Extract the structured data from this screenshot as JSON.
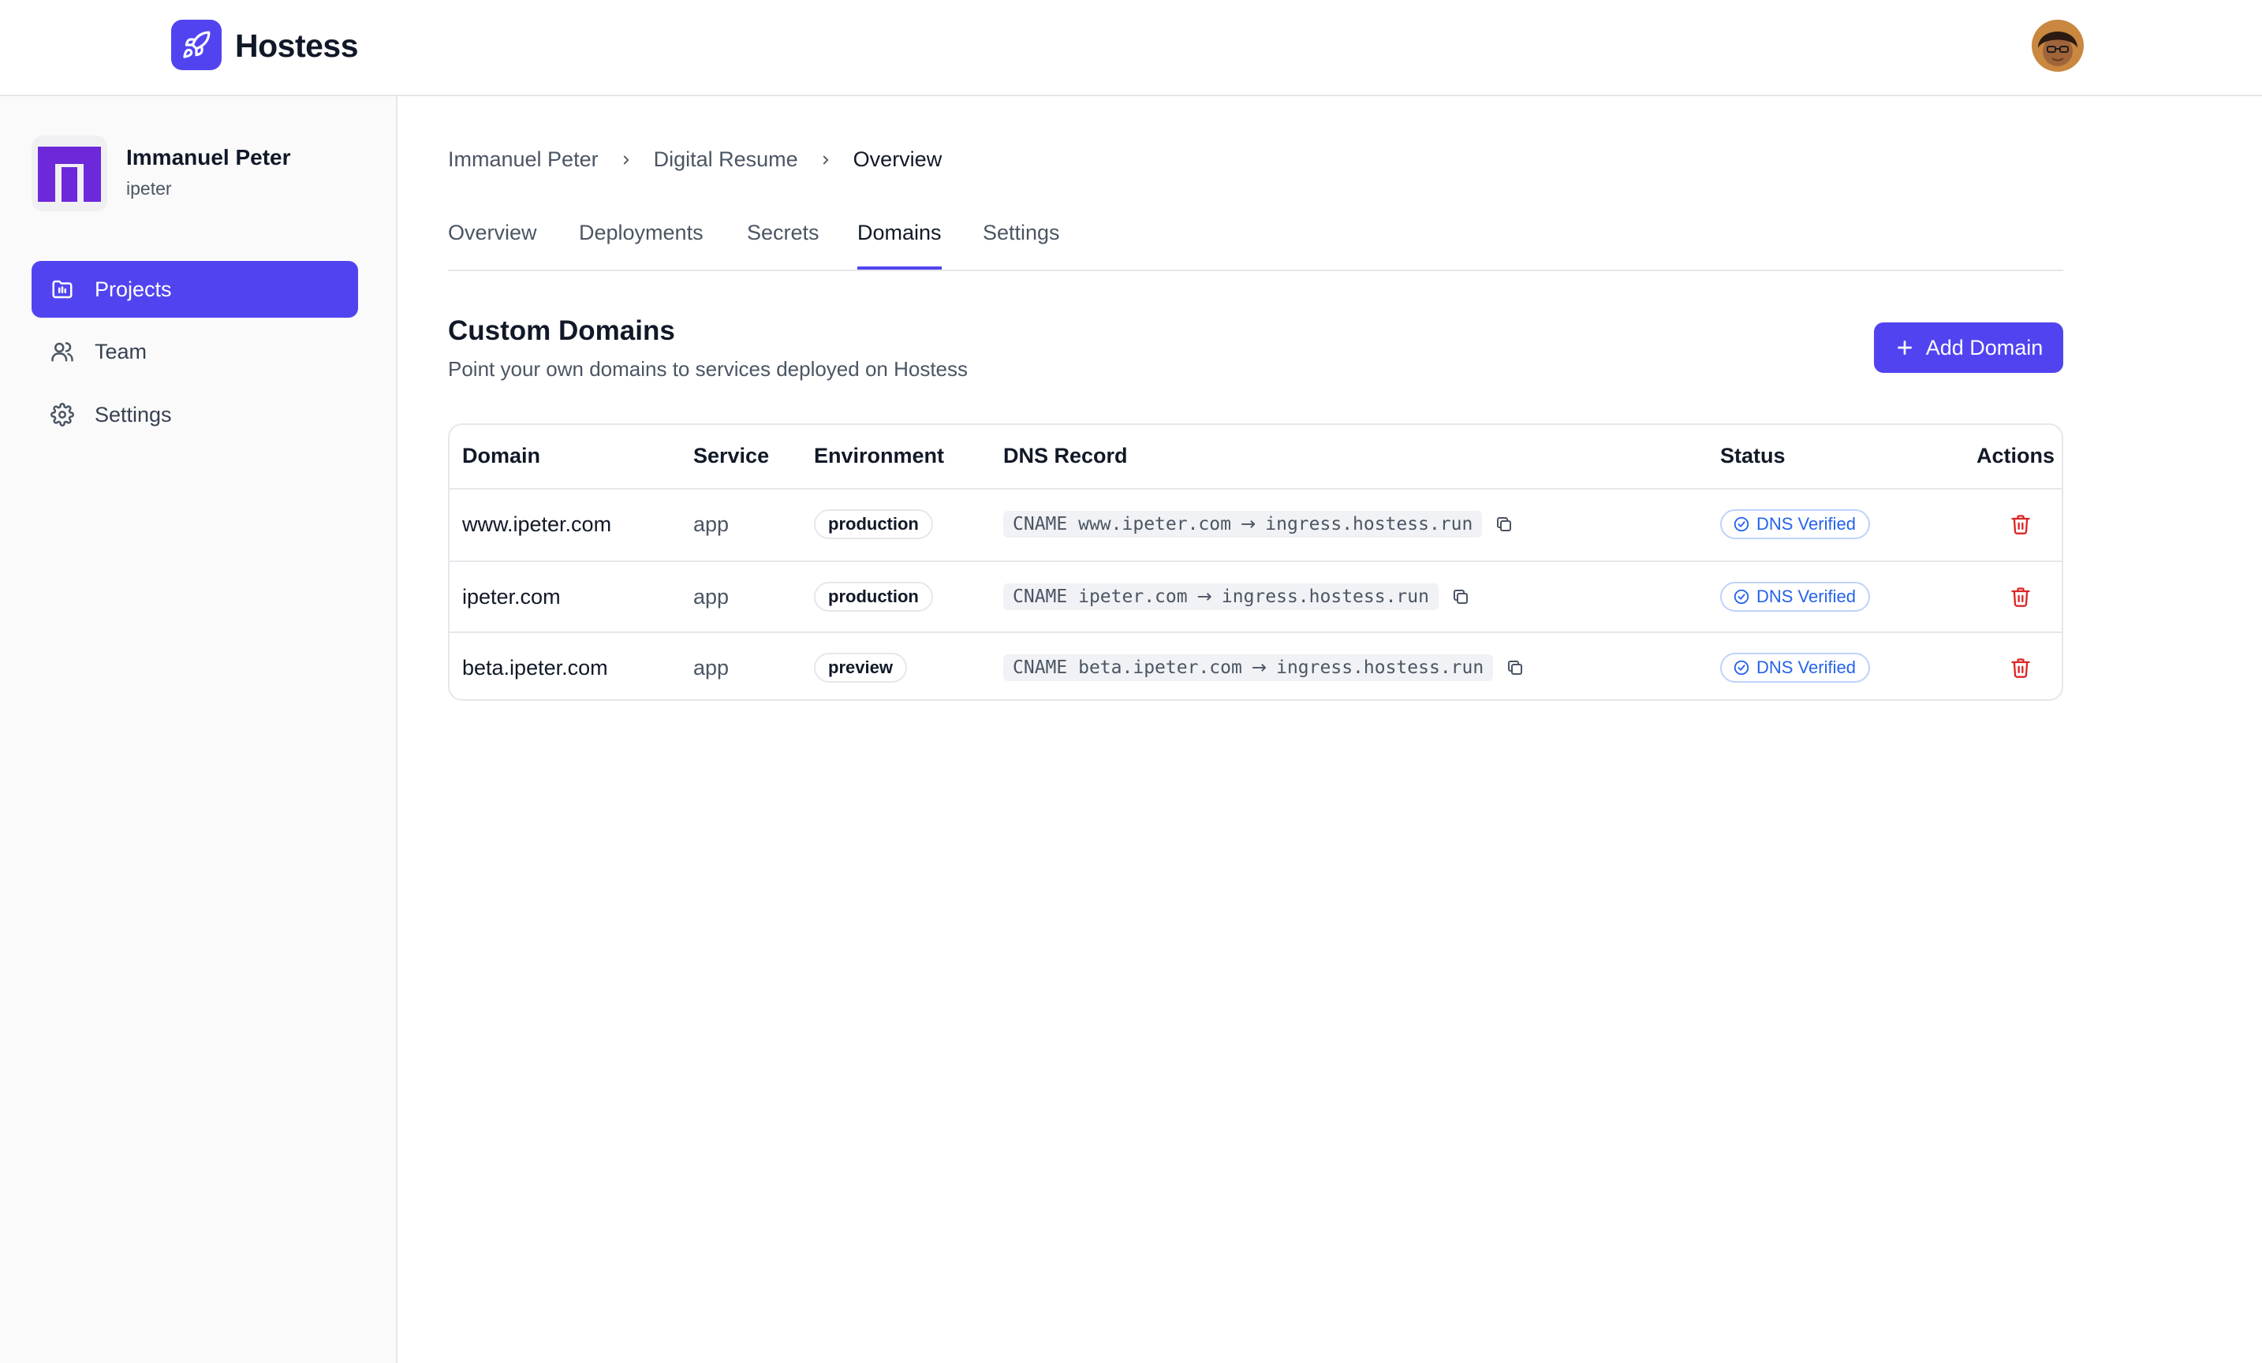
{
  "app": {
    "name": "Hostess",
    "logo_icon": "rocket-icon",
    "avatar_icon": "user-avatar"
  },
  "colors": {
    "accent": "#5144f0",
    "verified": "#2563eb",
    "danger": "#dc2626"
  },
  "org": {
    "name": "Immanuel Peter",
    "handle": "ipeter"
  },
  "sidebar": {
    "items": [
      {
        "label": "Projects",
        "icon": "folder-icon",
        "active": true
      },
      {
        "label": "Team",
        "icon": "users-icon",
        "active": false
      },
      {
        "label": "Settings",
        "icon": "gear-icon",
        "active": false
      }
    ]
  },
  "breadcrumb": [
    "Immanuel Peter",
    "Digital Resume",
    "Overview"
  ],
  "tabs": [
    {
      "label": "Overview",
      "active": false
    },
    {
      "label": "Deployments",
      "active": false
    },
    {
      "label": "Secrets",
      "active": false
    },
    {
      "label": "Domains",
      "active": true
    },
    {
      "label": "Settings",
      "active": false
    }
  ],
  "section": {
    "title": "Custom Domains",
    "subtitle": "Point your own domains to services deployed on Hostess",
    "add_button": "Add Domain"
  },
  "table": {
    "headers": {
      "domain": "Domain",
      "service": "Service",
      "environment": "Environment",
      "dns": "DNS Record",
      "status": "Status",
      "actions": "Actions"
    },
    "rows": [
      {
        "domain": "www.ipeter.com",
        "service": "app",
        "environment": "production",
        "dns_type": "CNAME",
        "dns_name": "www.ipeter.com",
        "dns_target": "ingress.hostess.run",
        "status": "DNS Verified"
      },
      {
        "domain": "ipeter.com",
        "service": "app",
        "environment": "production",
        "dns_type": "CNAME",
        "dns_name": "ipeter.com",
        "dns_target": "ingress.hostess.run",
        "status": "DNS Verified"
      },
      {
        "domain": "beta.ipeter.com",
        "service": "app",
        "environment": "preview",
        "dns_type": "CNAME",
        "dns_name": "beta.ipeter.com",
        "dns_target": "ingress.hostess.run",
        "status": "DNS Verified"
      }
    ]
  }
}
